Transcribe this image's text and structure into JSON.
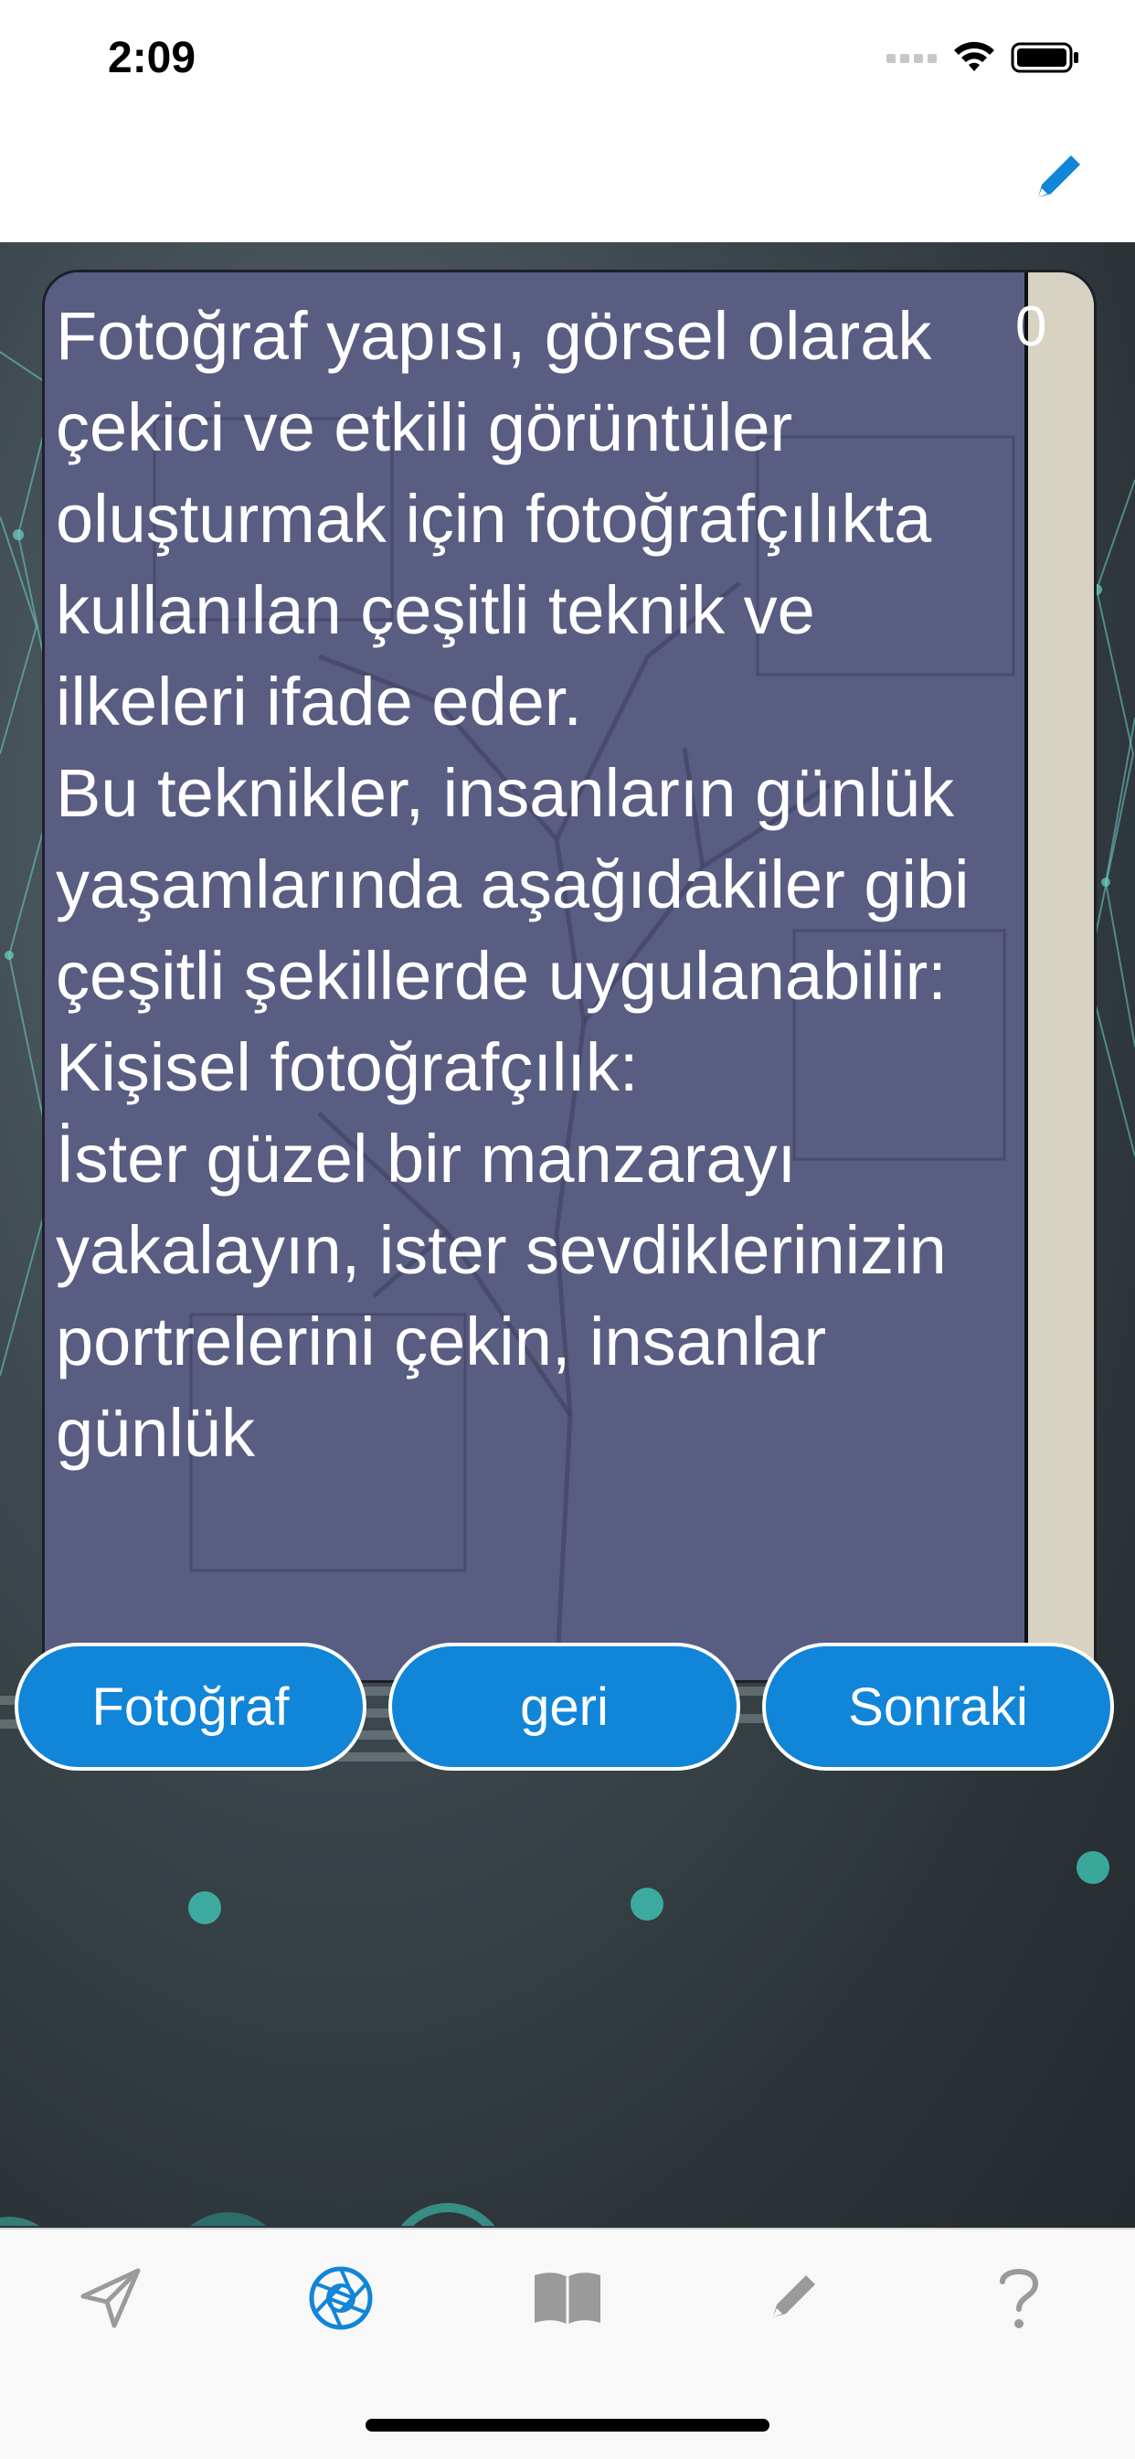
{
  "status_bar": {
    "time": "2:09"
  },
  "nav_bar": {
    "edit_icon": "pencil-icon"
  },
  "card": {
    "text": "Fotoğraf yapısı, görsel olarak çekici ve etkili görüntüler oluşturmak için fotoğrafçılıkta kullanılan çeşitli teknik ve ilkeleri ifade eder.\nBu teknikler, insanların günlük yaşamlarında aşağıdakiler gibi çeşitli şekillerde uygulanabilir:\nKişisel fotoğrafçılık:\nİster güzel bir manzarayı yakalayın, ister sevdiklerinizin portrelerini çekin, insanlar günlük",
    "counter": "0"
  },
  "buttons": {
    "photo": "Fotoğraf",
    "back": "geri",
    "next": "Sonraki"
  },
  "tab_bar": {
    "items": [
      {
        "icon": "paper-plane-icon",
        "active": false
      },
      {
        "icon": "camera-aperture-icon",
        "active": true
      },
      {
        "icon": "book-icon",
        "active": false
      },
      {
        "icon": "pencil-icon",
        "active": false
      },
      {
        "icon": "question-mark-icon",
        "active": false
      }
    ]
  },
  "colors": {
    "accent": "#1185d8",
    "tab_inactive": "#9a9a9a",
    "card_overlay": "#505480"
  }
}
